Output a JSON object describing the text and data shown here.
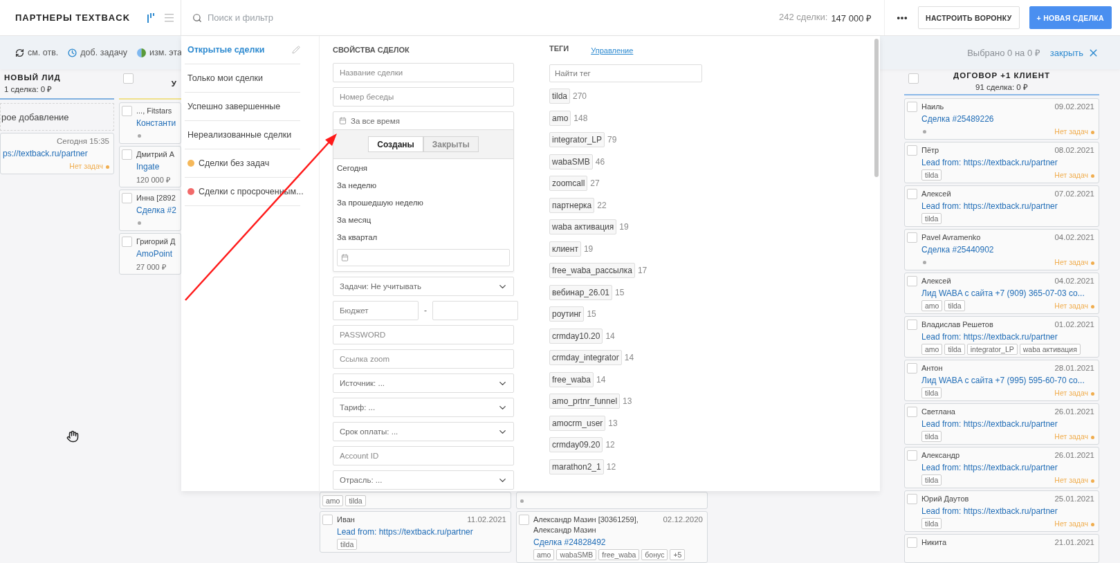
{
  "header": {
    "title": "ПАРТНЕРЫ TEXTBACK",
    "search": {
      "placeholder": "Поиск и фильтр"
    },
    "summary_label": "242 сделки:",
    "summary_value": "147 000 ₽",
    "buttons": [
      {
        "label": "НАСТРОИТЬ ВОРОНКУ",
        "kind": "secondary"
      },
      {
        "label": "+ НОВАЯ СДЕЛКА",
        "kind": "primary"
      }
    ]
  },
  "toolbar": {
    "actions": [
      {
        "label": "см. отв.",
        "kind": "refresh"
      },
      {
        "label": "доб. задачу",
        "kind": "clock"
      },
      {
        "label": "изм. эта",
        "kind": "stage"
      }
    ],
    "selection": "Выбрано 0 на 0 ₽",
    "close": "закрыть"
  },
  "board": {
    "columns": [
      {
        "kind": "cut",
        "title": "НОВЫЙ ЛИД",
        "count": "1 сделка: 0 ₽",
        "color": "#7fb0e0",
        "quick_add": "рое добавление",
        "cards": [
          {
            "date": "Сегодня 15:35",
            "title": "ps://textback.ru/partner",
            "status": "Нет задач"
          }
        ]
      },
      {
        "kind": "clipped",
        "title": "У",
        "checked": false,
        "color": "#f0e08a",
        "cards": [
          {
            "checked": false,
            "name": "..., Fitstars",
            "title": "Константи",
            "dot": true
          },
          {
            "checked": false,
            "name": "Дмитрий А",
            "title": "Ingate",
            "amount": "120 000 ₽"
          },
          {
            "checked": false,
            "name": "Инна [2892",
            "title": "Сделка #2",
            "dot": true
          },
          {
            "checked": false,
            "name": "Григорий Д",
            "title": "AmoPoint",
            "amount": "27 000 ₽"
          }
        ]
      },
      {
        "kind": "lower",
        "cards": [
          {
            "tags": [
              "amo",
              "tilda"
            ]
          },
          {
            "checked": false,
            "name": "Иван",
            "date": "11.02.2021",
            "title": "Lead from: https://textback.ru/partner",
            "tags": [
              "tilda"
            ]
          }
        ]
      },
      {
        "kind": "lower",
        "cards": [
          {
            "dot": true
          },
          {
            "checked": false,
            "name": "Александр Мазин [30361259], Александр Мазин",
            "date": "02.12.2020",
            "title": "Сделка #24828492",
            "tags": [
              "amo",
              "wabaSMB",
              "free_waba",
              "бонус",
              "+5"
            ]
          }
        ]
      },
      {
        "kind": "full",
        "title": "ДОГОВОР +1 КЛИЕНТ",
        "count": "91 сделка: 0 ₽",
        "checked": false,
        "color": "#8bb8e8",
        "cards": [
          {
            "checked": false,
            "name": "Наиль",
            "date": "09.02.2021",
            "title": "Сделка #25489226",
            "dot": true,
            "status": "Нет задач"
          },
          {
            "checked": false,
            "name": "Пётр",
            "date": "08.02.2021",
            "title": "Lead from: https://textback.ru/partner",
            "tags": [
              "tilda"
            ],
            "status": "Нет задач"
          },
          {
            "checked": false,
            "name": "Алексей",
            "date": "07.02.2021",
            "title": "Lead from: https://textback.ru/partner",
            "tags": [
              "tilda"
            ]
          },
          {
            "checked": false,
            "name": "Pavel Avramenko",
            "date": "04.02.2021",
            "title": "Сделка #25440902",
            "dot": true,
            "status": "Нет задач"
          },
          {
            "checked": false,
            "name": "Алексей",
            "date": "04.02.2021",
            "title": "Лид WABA с сайта +7 (909) 365-07-03 со...",
            "tags": [
              "amo",
              "tilda"
            ],
            "status": "Нет задач"
          },
          {
            "checked": false,
            "name": "Владислав Решетов",
            "date": "01.02.2021",
            "title": "Lead from: https://textback.ru/partner",
            "tags": [
              "amo",
              "tilda",
              "integrator_LP",
              "waba активация"
            ]
          },
          {
            "checked": false,
            "name": "Антон",
            "date": "28.01.2021",
            "title": "Лид WABA с сайта +7 (995) 595-60-70 со...",
            "tags": [
              "tilda"
            ],
            "status": "Нет задач"
          },
          {
            "checked": false,
            "name": "Светлана",
            "date": "26.01.2021",
            "title": "Lead from: https://textback.ru/partner",
            "tags": [
              "tilda"
            ],
            "status": "Нет задач"
          },
          {
            "checked": false,
            "name": "Александр",
            "date": "26.01.2021",
            "title": "Lead from: https://textback.ru/partner",
            "tags": [
              "tilda"
            ],
            "status": "Нет задач"
          },
          {
            "checked": false,
            "name": "Юрий Даутов",
            "date": "25.01.2021",
            "title": "Lead from: https://textback.ru/partner",
            "tags": [
              "tilda"
            ],
            "status": "Нет задач"
          },
          {
            "checked": false,
            "name": "Никита",
            "date": "21.01.2021"
          }
        ]
      }
    ]
  },
  "filter": {
    "presets": [
      {
        "label": "Открытые сделки",
        "selected": true
      },
      {
        "label": "Только мои сделки",
        "selected": false
      },
      {
        "label": "Успешно завершенные",
        "selected": false
      },
      {
        "label": "Нереализованные сделки",
        "selected": false
      },
      {
        "label": "Сделки без задач",
        "selected": false,
        "color": "#f5b85a"
      },
      {
        "label": "Сделки с просроченным...",
        "selected": false,
        "color": "#f26a6a"
      }
    ],
    "properties": {
      "title": "СВОЙСТВА СДЕЛОК",
      "fields": [
        {
          "kind": "input",
          "placeholder": "Название сделки"
        },
        {
          "kind": "input",
          "placeholder": "Номер беседы"
        },
        {
          "kind": "period",
          "value": "За все время",
          "expanded": true,
          "tabs": [
            {
              "label": "Созданы",
              "selected": true
            },
            {
              "label": "Закрыты",
              "selected": false
            }
          ],
          "options": [
            "Сегодня",
            "За неделю",
            "За прошедшую неделю",
            "За месяц",
            "За квартал"
          ]
        },
        {
          "kind": "select",
          "value": "Задачи: Не учитывать"
        },
        {
          "kind": "range",
          "placeholder": "Бюджет",
          "separator": "-"
        },
        {
          "kind": "input",
          "placeholder": "PASSWORD"
        },
        {
          "kind": "input",
          "placeholder": "Ссылка zoom"
        },
        {
          "kind": "select",
          "value": "Источник: ..."
        },
        {
          "kind": "select",
          "value": "Тариф: ..."
        },
        {
          "kind": "select",
          "value": "Срок оплаты: ..."
        },
        {
          "kind": "input",
          "placeholder": "Account ID"
        },
        {
          "kind": "select",
          "value": "Отрасль: ..."
        }
      ]
    },
    "tags": {
      "title": "ТЕГИ",
      "link": "Управление",
      "search": {
        "placeholder": "Найти тег"
      },
      "items": [
        {
          "name": "tilda",
          "count": "270"
        },
        {
          "name": "amo",
          "count": "148"
        },
        {
          "name": "integrator_LP",
          "count": "79"
        },
        {
          "name": "wabaSMB",
          "count": "46"
        },
        {
          "name": "zoomcall",
          "count": "27"
        },
        {
          "name": "партнерка",
          "count": "22"
        },
        {
          "name": "waba активация",
          "count": "19"
        },
        {
          "name": "клиент",
          "count": "19"
        },
        {
          "name": "free_waba_рассылка",
          "count": "17"
        },
        {
          "name": "вебинар_26.01",
          "count": "15"
        },
        {
          "name": "роутинг",
          "count": "15"
        },
        {
          "name": "crmday10.20",
          "count": "14"
        },
        {
          "name": "crmday_integrator",
          "count": "14"
        },
        {
          "name": "free_waba",
          "count": "14"
        },
        {
          "name": "amo_prtnr_funnel",
          "count": "13"
        },
        {
          "name": "amocrm_user",
          "count": "13"
        },
        {
          "name": "crmday09.20",
          "count": "12"
        },
        {
          "name": "marathon2_1",
          "count": "12"
        }
      ]
    }
  }
}
